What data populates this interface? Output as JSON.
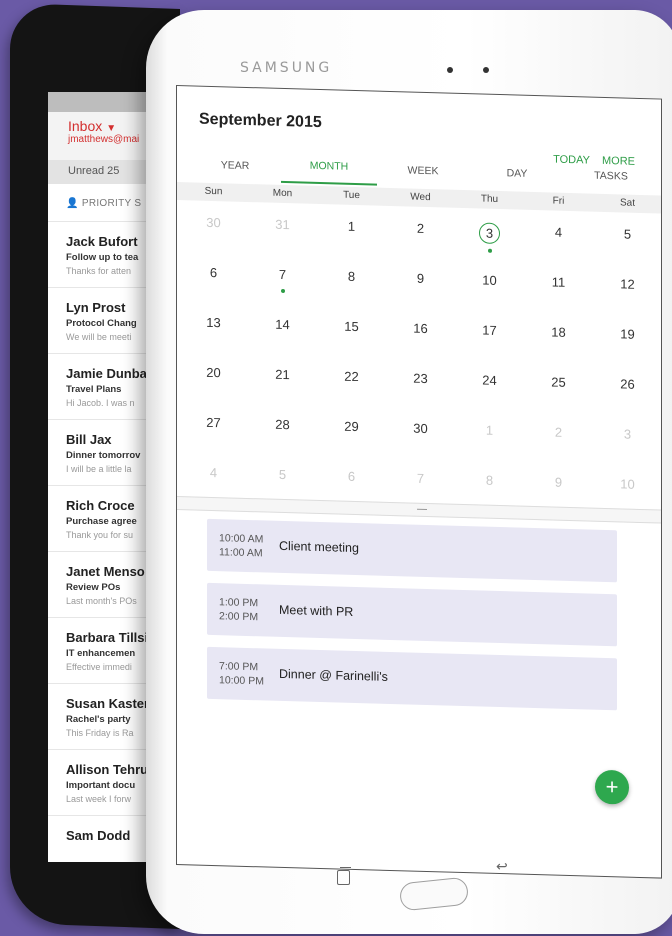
{
  "email": {
    "title": "Inbox",
    "account": "jmatthews@mai",
    "unread_label": "Unread 25",
    "priority_label": "PRIORITY S",
    "messages": [
      {
        "from": "Jack Bufort",
        "subject": "Follow up to tea",
        "preview": "Thanks for atten"
      },
      {
        "from": "Lyn Prost",
        "subject": "Protocol Chang",
        "preview": "We will be meeti"
      },
      {
        "from": "Jamie Dunba",
        "subject": "Travel Plans",
        "preview": "Hi Jacob. I was n"
      },
      {
        "from": "Bill Jax",
        "subject": "Dinner tomorrov",
        "preview": "I will be a little la"
      },
      {
        "from": "Rich Croce",
        "subject": "Purchase agree",
        "preview": "Thank you for su"
      },
      {
        "from": "Janet Menso",
        "subject": "Review POs",
        "preview": "Last month's POs"
      },
      {
        "from": "Barbara Tillsi",
        "subject": "IT enhancemen",
        "preview": "Effective immedi"
      },
      {
        "from": "Susan Kaster",
        "subject": "Rachel's party",
        "preview": "This Friday is Ra"
      },
      {
        "from": "Allison Tehru",
        "subject": "Important docu",
        "preview": "Last week I forw"
      },
      {
        "from": "Sam Dodd",
        "subject": "",
        "preview": ""
      }
    ]
  },
  "device": {
    "brand": "SAMSUNG"
  },
  "calendar": {
    "title": "September 2015",
    "actions": {
      "today": "TODAY",
      "more": "MORE"
    },
    "views": [
      "YEAR",
      "MONTH",
      "WEEK",
      "DAY",
      "TASKS"
    ],
    "active_view": "MONTH",
    "weekdays": [
      "Sun",
      "Mon",
      "Tue",
      "Wed",
      "Thu",
      "Fri",
      "Sat"
    ],
    "weeks": [
      [
        "30",
        "31",
        "1",
        "2",
        "3",
        "4",
        "5"
      ],
      [
        "6",
        "7",
        "8",
        "9",
        "10",
        "11",
        "12"
      ],
      [
        "13",
        "14",
        "15",
        "16",
        "17",
        "18",
        "19"
      ],
      [
        "20",
        "21",
        "22",
        "23",
        "24",
        "25",
        "26"
      ],
      [
        "27",
        "28",
        "29",
        "30",
        "1",
        "2",
        "3"
      ],
      [
        "4",
        "5",
        "6",
        "7",
        "8",
        "9",
        "10"
      ]
    ],
    "today": "3",
    "days_with_events": [
      "3",
      "7"
    ],
    "events": [
      {
        "start": "10:00 AM",
        "end": "11:00 AM",
        "title": "Client meeting"
      },
      {
        "start": "1:00 PM",
        "end": "2:00 PM",
        "title": "Meet with PR"
      },
      {
        "start": "7:00 PM",
        "end": "10:00 PM",
        "title": "Dinner @ Farinelli's"
      }
    ],
    "add_label": "+"
  },
  "colors": {
    "accent": "#2e9d47",
    "background": "#6a5aa6",
    "event_bg": "#e8e7f4",
    "inbox_red": "#d32f2f"
  }
}
